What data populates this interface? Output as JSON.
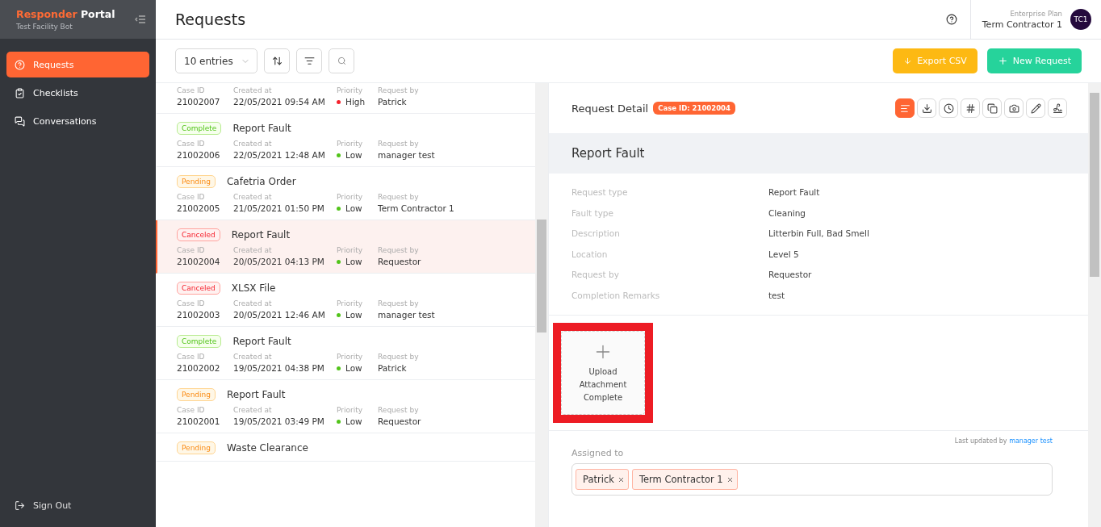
{
  "brand": {
    "name_accent": "Responder",
    "name": "Portal",
    "subtitle": "Test Facility Bot"
  },
  "nav": [
    {
      "label": "Requests",
      "selected": true
    },
    {
      "label": "Checklists",
      "selected": false
    },
    {
      "label": "Conversations",
      "selected": false
    }
  ],
  "sign_out": "Sign Out",
  "page_title": "Requests",
  "account": {
    "plan": "Enterprise Plan",
    "name": "Term Contractor 1",
    "initials": "TC1"
  },
  "toolbar": {
    "entries": "10 entries",
    "export": "Export CSV",
    "new_request": "New Request"
  },
  "requests": [
    {
      "kind": "partial",
      "selected": false,
      "meta": [
        {
          "label": "Case ID",
          "value": "21002007"
        },
        {
          "label": "Created at",
          "value": "22/05/2021 09:54 AM"
        },
        {
          "label": "Priority",
          "value": "High",
          "color": "#f5222d"
        },
        {
          "label": "Request by",
          "value": "Patrick"
        }
      ]
    },
    {
      "kind": "full",
      "selected": false,
      "status": {
        "label": "Complete",
        "kind": "complete"
      },
      "title": "Report Fault",
      "meta": [
        {
          "label": "Case ID",
          "value": "21002006"
        },
        {
          "label": "Created at",
          "value": "22/05/2021 12:48 AM"
        },
        {
          "label": "Priority",
          "value": "Low",
          "color": "#52c41a"
        },
        {
          "label": "Request by",
          "value": "manager test"
        }
      ]
    },
    {
      "kind": "full",
      "selected": false,
      "status": {
        "label": "Pending",
        "kind": "pending"
      },
      "title": "Cafetria Order",
      "meta": [
        {
          "label": "Case ID",
          "value": "21002005"
        },
        {
          "label": "Created at",
          "value": "21/05/2021 01:50 PM"
        },
        {
          "label": "Priority",
          "value": "Low",
          "color": "#52c41a"
        },
        {
          "label": "Request by",
          "value": "Term Contractor 1"
        }
      ]
    },
    {
      "kind": "full",
      "selected": true,
      "status": {
        "label": "Canceled",
        "kind": "canceled"
      },
      "title": "Report Fault",
      "meta": [
        {
          "label": "Case ID",
          "value": "21002004"
        },
        {
          "label": "Created at",
          "value": "20/05/2021 04:13 PM"
        },
        {
          "label": "Priority",
          "value": "Low",
          "color": "#52c41a"
        },
        {
          "label": "Request by",
          "value": "Requestor"
        }
      ]
    },
    {
      "kind": "full",
      "selected": false,
      "status": {
        "label": "Canceled",
        "kind": "canceled"
      },
      "title": "XLSX File",
      "meta": [
        {
          "label": "Case ID",
          "value": "21002003"
        },
        {
          "label": "Created at",
          "value": "20/05/2021 12:46 AM"
        },
        {
          "label": "Priority",
          "value": "Low",
          "color": "#52c41a"
        },
        {
          "label": "Request by",
          "value": "manager test"
        }
      ]
    },
    {
      "kind": "full",
      "selected": false,
      "status": {
        "label": "Complete",
        "kind": "complete"
      },
      "title": "Report Fault",
      "meta": [
        {
          "label": "Case ID",
          "value": "21002002"
        },
        {
          "label": "Created at",
          "value": "19/05/2021 04:38 PM"
        },
        {
          "label": "Priority",
          "value": "Low",
          "color": "#52c41a"
        },
        {
          "label": "Request by",
          "value": "Patrick"
        }
      ]
    },
    {
      "kind": "full",
      "selected": false,
      "status": {
        "label": "Pending",
        "kind": "pending"
      },
      "title": "Report Fault",
      "meta": [
        {
          "label": "Case ID",
          "value": "21002001"
        },
        {
          "label": "Created at",
          "value": "19/05/2021 03:49 PM"
        },
        {
          "label": "Priority",
          "value": "Low",
          "color": "#52c41a"
        },
        {
          "label": "Request by",
          "value": "Requestor"
        }
      ]
    },
    {
      "kind": "header",
      "selected": false,
      "status": {
        "label": "Pending",
        "kind": "pending"
      },
      "title": "Waste Clearance"
    }
  ],
  "detail": {
    "heading": "Request Detail",
    "case_badge": "Case ID: 21002004",
    "actions": [
      {
        "selected": true
      },
      {
        "selected": false
      },
      {
        "selected": false
      },
      {
        "selected": false
      },
      {
        "selected": false
      },
      {
        "selected": false
      },
      {
        "selected": false
      },
      {
        "selected": false
      }
    ],
    "title": "Report Fault",
    "fields": [
      {
        "label": "Request type",
        "value": "Report Fault"
      },
      {
        "label": "Fault type",
        "value": "Cleaning"
      },
      {
        "label": "Description",
        "value": "Litterbin Full, Bad Smell"
      },
      {
        "label": "Location",
        "value": "Level 5"
      },
      {
        "label": "Request by",
        "value": "Requestor"
      },
      {
        "label": "Completion Remarks",
        "value": "test"
      }
    ],
    "upload": {
      "label": "Upload Attachment Complete",
      "highlighted": true
    },
    "last_updated_prefix": "Last updated by",
    "last_updated_by": "manager test",
    "assigned_label": "Assigned to",
    "assignees": [
      "Patrick",
      "Term Contractor 1"
    ]
  }
}
